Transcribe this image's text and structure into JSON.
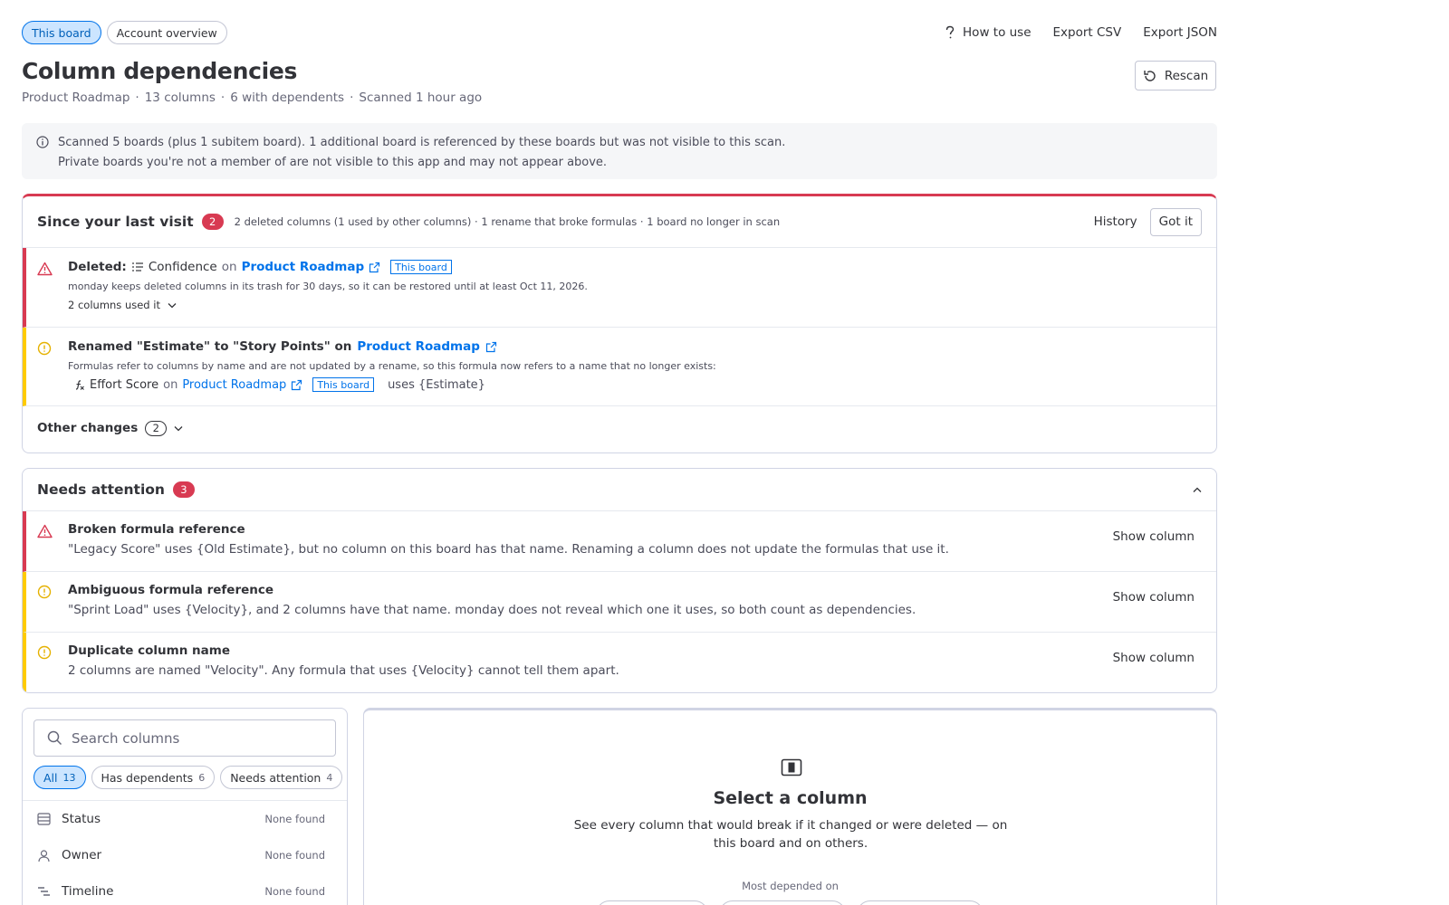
{
  "topbar": {
    "tabs": [
      "This board",
      "Account overview"
    ],
    "actions": {
      "help": "How to use",
      "export_csv": "Export CSV",
      "export_json": "Export JSON"
    }
  },
  "header": {
    "title": "Column dependencies",
    "board": "Product Roadmap",
    "columns": "13 columns",
    "dependents": "6 with dependents",
    "scanned": "Scanned 1 hour ago",
    "sep": "·",
    "rescan": "Rescan"
  },
  "info": {
    "line1": "Scanned 5 boards (plus 1 subitem board). 1 additional board is referenced by these boards but was not visible to this scan.",
    "line2": "Private boards you're not a member of are not visible to this app and may not appear above."
  },
  "since": {
    "title": "Since your last visit",
    "count": "2",
    "summary": "2 deleted columns (1 used by other columns) · 1 rename that broke formulas · 1 board no longer in scan",
    "history": "History",
    "got_it": "Got it",
    "deleted": {
      "label": "Deleted:",
      "column": "Confidence",
      "on": "on",
      "board": "Product Roadmap",
      "tag": "This board",
      "note": "monday keeps deleted columns in its trash for 30 days, so it can be restored until at least Oct 11, 2026.",
      "used": "2 columns used it"
    },
    "renamed": {
      "label": "Renamed \"Estimate\" to \"Story Points\" on",
      "board": "Product Roadmap",
      "note": "Formulas refer to columns by name and are not updated by a rename, so this formula now refers to a name that no longer exists:",
      "column": "Effort Score",
      "on": "on",
      "board2": "Product Roadmap",
      "tag": "This board",
      "uses": "uses {Estimate}"
    },
    "other": {
      "label": "Other changes",
      "count": "2"
    }
  },
  "attention": {
    "title": "Needs attention",
    "count": "3",
    "items": [
      {
        "title": "Broken formula reference",
        "desc": "\"Legacy Score\" uses {Old Estimate}, but no column on this board has that name. Renaming a column does not update the formulas that use it.",
        "action": "Show column"
      },
      {
        "title": "Ambiguous formula reference",
        "desc": "\"Sprint Load\" uses {Velocity}, and 2 columns have that name. monday does not reveal which one it uses, so both count as dependencies.",
        "action": "Show column"
      },
      {
        "title": "Duplicate column name",
        "desc": "2 columns are named \"Velocity\". Any formula that uses {Velocity} cannot tell them apart.",
        "action": "Show column"
      }
    ]
  },
  "columns_panel": {
    "search_placeholder": "Search columns",
    "filters": [
      {
        "label": "All",
        "count": "13"
      },
      {
        "label": "Has dependents",
        "count": "6"
      },
      {
        "label": "Needs attention",
        "count": "4"
      }
    ],
    "items": [
      {
        "name": "Status",
        "state": "None found",
        "icon": "status-icon"
      },
      {
        "name": "Owner",
        "state": "None found",
        "icon": "person-icon"
      },
      {
        "name": "Timeline",
        "state": "None found",
        "icon": "timeline-icon"
      }
    ]
  },
  "detail": {
    "title": "Select a column",
    "desc": "See every column that would break if it changed or were deleted — on this board and on others.",
    "most": "Most depended on"
  },
  "colors": {
    "accent": "#0073ea",
    "danger": "#d83a52",
    "warning": "#ffcb00"
  }
}
